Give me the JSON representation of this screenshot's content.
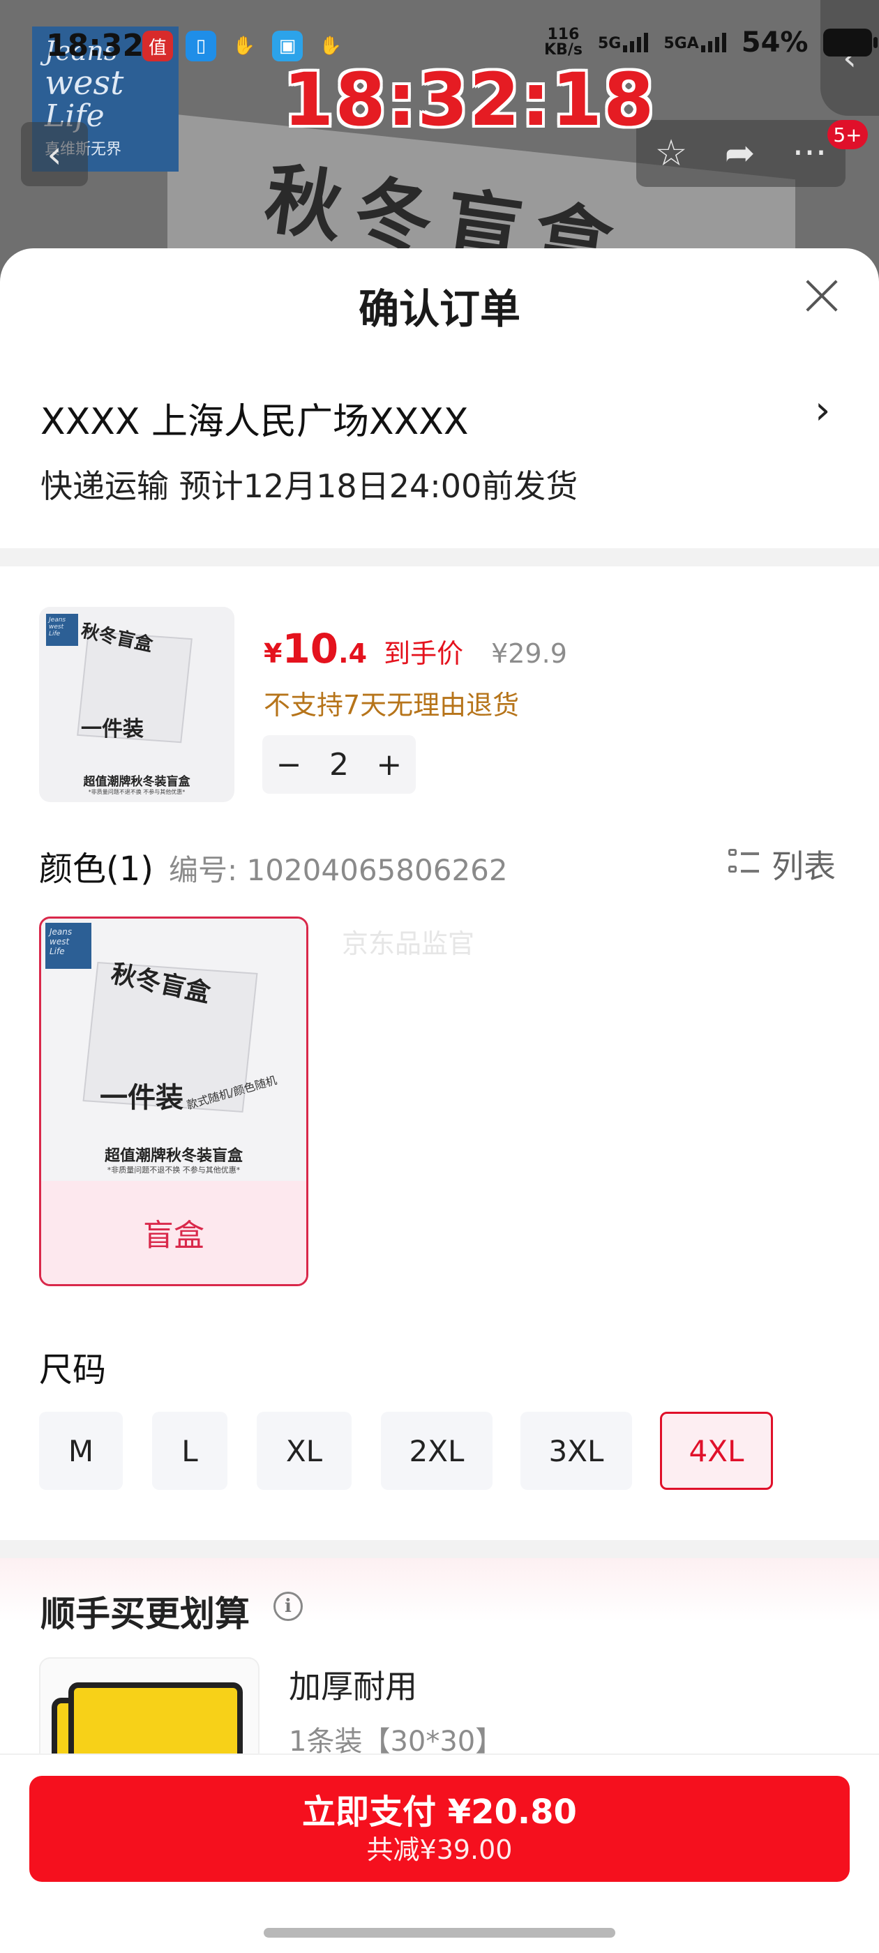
{
  "status_bar": {
    "time": "18:32",
    "net_speed_value": "116",
    "net_speed_unit": "KB/s",
    "signal_1": "5G",
    "signal_2": "5GA",
    "battery": "54%",
    "overlay_clock": "18:32:18"
  },
  "background": {
    "brand_lines": [
      "Jeans",
      "west",
      "Life",
      "真维斯无界"
    ],
    "box_text": "秋冬盲盒",
    "badge": "5+"
  },
  "sheet": {
    "title": "确认订单",
    "address": "XXXX  上海人民广场XXXX",
    "shipping": "快递运输 预计12月18日24:00前发货"
  },
  "product": {
    "price_symbol": "¥",
    "price_int": "10",
    "price_dec": ".4",
    "price_label": "到手价",
    "original_price": "¥29.9",
    "notice": "不支持7天无理由退货",
    "qty": "2",
    "minus": "−",
    "plus": "+",
    "image_text": {
      "box_top": "秋冬盲盒",
      "box_side": "一件装",
      "box_side2": "款式随机/颜色随机",
      "caption": "超值潮牌秋冬装盲盒",
      "fine_print": "*非质量问题不退不换 不参与其他优惠*"
    }
  },
  "color_section": {
    "label": "颜色(1)",
    "code": "编号: 10204065806262",
    "list_toggle": "列表",
    "watermark": "京东品监官",
    "variants": [
      {
        "label": "盲盒"
      }
    ]
  },
  "size_section": {
    "label": "尺码",
    "options": [
      "M",
      "L",
      "XL",
      "2XL",
      "3XL",
      "4XL"
    ],
    "selected": "4XL"
  },
  "upsell": {
    "title": "顺手买更划算",
    "info": "i",
    "item_name": "加厚耐用",
    "item_spec": "1条装【30*30】"
  },
  "footer": {
    "pay_label": "立即支付 ¥20.80",
    "discount": "共减¥39.00"
  },
  "colors": {
    "accent_red": "#e4121d",
    "pay_button": "#f5101e",
    "notice_orange": "#b6741a",
    "selected_border": "#e0102a"
  },
  "icons": [
    "back-arrow-icon",
    "star-icon",
    "share-icon",
    "more-icon",
    "close-icon",
    "chevron-right-icon",
    "list-icon",
    "info-icon"
  ]
}
